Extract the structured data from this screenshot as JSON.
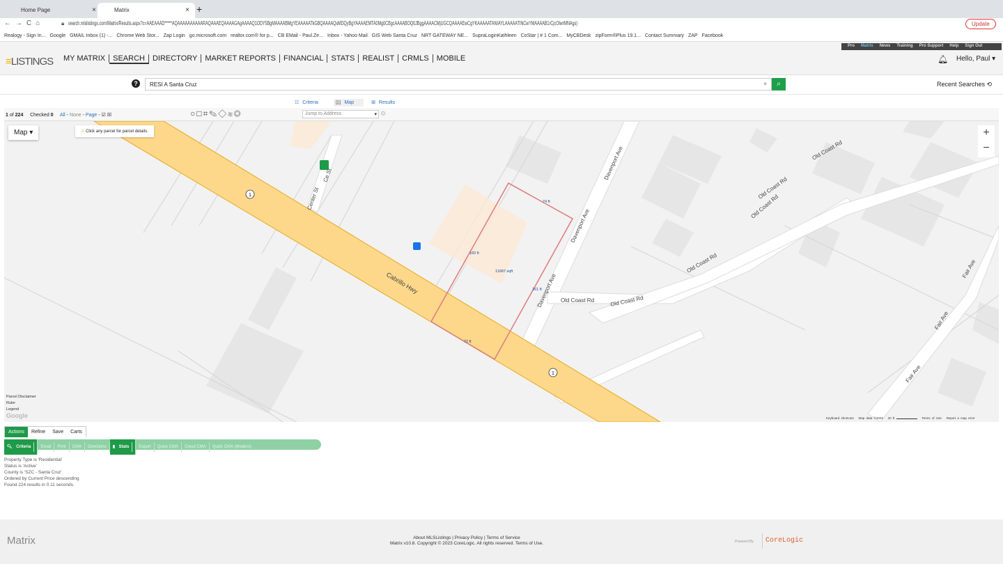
{
  "browser": {
    "tabs": [
      {
        "label": "Home Page"
      },
      {
        "label": "Matrix"
      }
    ],
    "url": "search.mlslistings.com/Matrix/Results.aspx?c=AAEAAAD*****AQAAAAAAAAAARAQAAAEQAAAAGAgAAAAQ1ODY5BgMAAAABMgYEAAAAATkGBQAAAAQxMDQyBgYAAAAEMTA0Mg0CBgcAAAABOQ0JBggAAAACMjUGCQAAAAEwCgYKAAAAATANIAYLAAAAATINCwYMAAAAB1rCjcOlwrMNAgs)",
    "update_label": "Update",
    "bookmarks": [
      "Realogy - Sign In...",
      "Google",
      "GMAIL Inbox (1) -...",
      "Chrome Web Stor...",
      "Zap Login",
      "go.microsoft.com",
      "realtor.com® for p...",
      "CB EMail - Paul.Ze...",
      "Inbox - Yahoo Mail",
      "GIS Web Santa Cruz",
      "NRT GATEWAY NE...",
      "SupraLoginKathleen",
      "CoStar | # 1 Com...",
      "MyCBDesk",
      "zipForm®Plus 19.1...",
      "Contact Summary",
      "ZAP",
      "Facebook"
    ]
  },
  "header": {
    "logo": "MLS LISTINGS",
    "nav": [
      "MY MATRIX",
      "SEARCH",
      "DIRECTORY",
      "MARKET REPORTS",
      "FINANCIAL",
      "STATS",
      "REALIST",
      "CRMLS",
      "MOBILE"
    ],
    "pro_links": [
      "Pro",
      "Matrix",
      "News",
      "Training",
      "Pro Support",
      "Help",
      "Sign Out"
    ],
    "greeting": "Hello, Paul"
  },
  "search": {
    "value": "RESI A Santa Cruz",
    "recent": "Recent Searches"
  },
  "view_tabs": [
    "Criteria",
    "Map",
    "Results"
  ],
  "toolbar": {
    "position": "1",
    "of": "of",
    "total": "224",
    "checked_label": "Checked",
    "checked": "0",
    "all": "All",
    "none": "None",
    "page": "Page",
    "jump_placeholder": "Jump to Address"
  },
  "map": {
    "type_label": "Map",
    "hint": "Click any parcel for parcel details.",
    "labels": {
      "cabrillo": "Cabrillo Hwy",
      "center": "Center St",
      "ce": "Ce St",
      "davenport1": "Davenport Ave",
      "davenport2": "Davenport Ave",
      "davenport3": "Davenport Ave",
      "oldcoast1": "Old Coast Rd",
      "oldcoast2": "Old Coast Rd",
      "oldcoast3": "Old Coast Rd",
      "oldcoast4": "Old Coast Rd",
      "oldcoast5": "Old Coast Rd",
      "oldcoast6": "Old Coast Rd",
      "fair1": "Fair Ave",
      "fair2": "Fair Ave",
      "fair3": "Fair Ave",
      "hwy_shield": "1"
    },
    "parcel": {
      "top": "74 ft",
      "left": "160 ft",
      "right": "161 ft",
      "bottom": "72 ft",
      "area": "11687 sqft"
    },
    "links": [
      "Parcel Disclaimer",
      "Ruler",
      "Legend"
    ],
    "attribution": [
      "Keyboard shortcuts",
      "Map data ©2023",
      "20 ft",
      "Terms of Use",
      "Report a map error"
    ],
    "colors": {
      "highway": "#fdd88a",
      "parcel": "#e08080"
    }
  },
  "actions": {
    "tabs": [
      "Actions",
      "Refine",
      "Save",
      "Carts"
    ],
    "buttons": [
      "Criteria",
      "Email",
      "Print",
      "CMA",
      "Directions",
      "Stats",
      "Export",
      "Quick CMA",
      "Cloud CMA",
      "Quick CMA (Modern)"
    ]
  },
  "criteria": [
    "Property Type is 'Residential'",
    "Status is 'Active'",
    "County is 'SZC - Santa Cruz'",
    "Ordered by Current Price descending",
    "Found 224 results in 0.11 seconds."
  ],
  "footer": {
    "brand": "Matrix",
    "links": "About MLSListings | Privacy Policy | Terms of Service",
    "copyright": "Matrix v10.8. Copyright © 2023 CoreLogic. All rights reserved. Terms of Use.",
    "powered": "Powered By",
    "corelogic": "CoreLogic"
  }
}
